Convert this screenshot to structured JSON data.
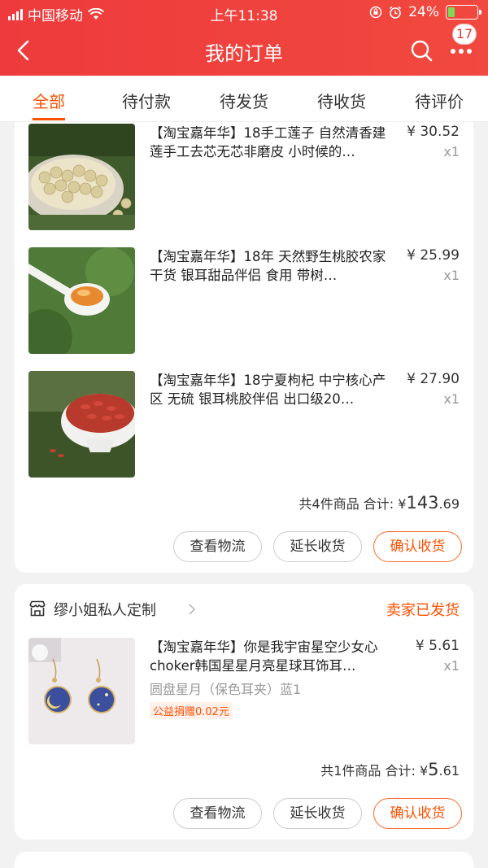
{
  "status_bar": {
    "carrier": "中国移动",
    "time": "上午11:38",
    "battery": "24%"
  },
  "nav": {
    "title": "我的订单",
    "badge": "17"
  },
  "tabs": [
    {
      "label": "全部"
    },
    {
      "label": "待付款"
    },
    {
      "label": "待发货"
    },
    {
      "label": "待收货"
    },
    {
      "label": "待评价"
    }
  ],
  "order1": {
    "items": [
      {
        "title": "【淘宝嘉年华】18手工莲子 自然清香建莲手工去芯无芯非磨皮 小时候的…",
        "price": "¥ 30.52",
        "qty": "x1"
      },
      {
        "title": "【淘宝嘉年华】18年 天然野生桃胶农家干货 银耳甜品伴侣 食用 带树…",
        "price": "¥ 25.99",
        "qty": "x1"
      },
      {
        "title": "【淘宝嘉年华】18宁夏枸杞 中宁核心产区 无硫 银耳桃胶伴侣 出口级20…",
        "price": "¥ 27.90",
        "qty": "x1"
      }
    ],
    "summary_prefix": "共4件商品 合计: ¥",
    "total_int": "143",
    "total_dec": ".69",
    "buttons": {
      "logistics": "查看物流",
      "extend": "延长收货",
      "confirm": "确认收货"
    }
  },
  "order2": {
    "shop": "缪小姐私人定制",
    "status": "卖家已发货",
    "item": {
      "title": "【淘宝嘉年华】你是我宇宙星空少女心choker韩国星星月亮星球耳饰耳…",
      "price": "¥ 5.61",
      "qty": "x1",
      "sku": "圆盘星月（保色耳夹）蓝1",
      "charity": "公益捐赠0.02元"
    },
    "summary_prefix": "共1件商品 合计: ¥",
    "total_int": "5",
    "total_dec": ".61",
    "buttons": {
      "logistics": "查看物流",
      "extend": "延长收货",
      "confirm": "确认收货"
    }
  },
  "colors": {
    "header": "#ee3a3c",
    "accent": "#ff5000",
    "battery_fill": "#7ed957"
  },
  "icons": [
    "back-icon",
    "search-icon",
    "more-icon",
    "shop-icon",
    "wifi-icon",
    "lock-icon",
    "alarm-icon"
  ]
}
